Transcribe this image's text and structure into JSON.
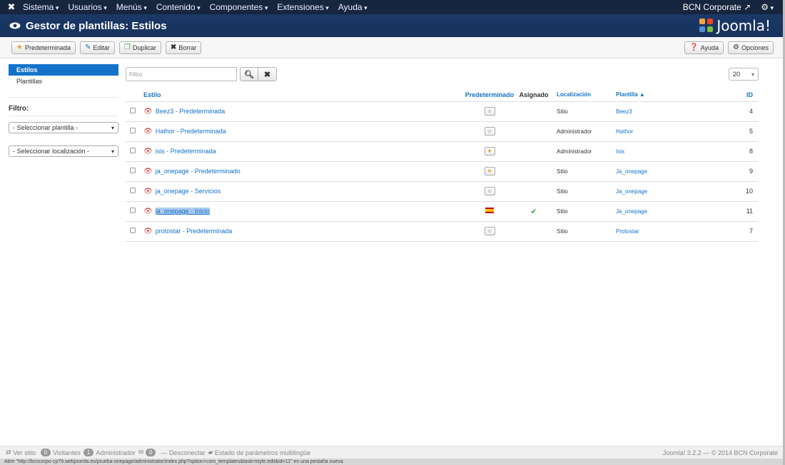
{
  "topnav": {
    "menu": [
      "Sistema",
      "Usuarios",
      "Menús",
      "Contenido",
      "Componentes",
      "Extensiones",
      "Ayuda"
    ],
    "site_name": "BCN Corporate"
  },
  "header": {
    "title": "Gestor de plantillas: Estilos",
    "brand": "Joomla!"
  },
  "toolbar": {
    "default_label": "Predeterminada",
    "edit_label": "Editar",
    "duplicate_label": "Duplicar",
    "delete_label": "Borrar",
    "help_label": "Ayuda",
    "options_label": "Opciones"
  },
  "sidebar": {
    "items": [
      "Estilos",
      "Plantillas"
    ],
    "filter_title": "Filtro:",
    "select_template": "- Seleccionar plantilla -",
    "select_location": "- Seleccionar localización -"
  },
  "filter": {
    "placeholder": "Filtro:",
    "limit": "20"
  },
  "table": {
    "headers": {
      "style": "Estilo",
      "default": "Predeterminado",
      "assigned": "Asignado",
      "location": "Localización",
      "template": "Plantilla ▲",
      "id": "ID"
    },
    "rows": [
      {
        "name": "Beez3 - Predeterminada",
        "default": "off",
        "location": "Sitio",
        "template": "Beez3",
        "id": "4"
      },
      {
        "name": "Hathor - Predeterminada",
        "default": "off",
        "location": "Administrador",
        "template": "Hathor",
        "id": "5"
      },
      {
        "name": "isis - Predeterminada",
        "default": "on",
        "location": "Administrador",
        "template": "Isis",
        "id": "8"
      },
      {
        "name": "ja_onepage - Predeterminado",
        "default": "on",
        "location": "Sitio",
        "template": "Ja_onepage",
        "id": "9"
      },
      {
        "name": "ja_onepage - Servicios",
        "default": "off",
        "location": "Sitio",
        "template": "Ja_onepage",
        "id": "10"
      },
      {
        "name": "ja_onepage - Inicio",
        "default": "flag",
        "assigned": true,
        "location": "Sitio",
        "template": "Ja_onepage",
        "id": "11"
      },
      {
        "name": "protostar - Predeterminada",
        "default": "off",
        "location": "Sitio",
        "template": "Protostar",
        "id": "7"
      }
    ]
  },
  "footer": {
    "view_site": "Ver sitio",
    "visitors_count": "0",
    "visitors": "Visitantes",
    "admin_count": "1",
    "admin": "Administrador",
    "msg_count": "0",
    "logout": "Desconectar",
    "multilang": "Estado de parámetros multilingüe",
    "copyright": "Joomla! 3.2.2 — © 2014 BCN Corporate"
  },
  "status_bar": "Abrir \"http://bcncorpo-cp79.webjoomla.es/prueba-onepage/administrator/index.php?option=com_templates&task=style.edit&id=11\" en una pestaña nueva",
  "colors": {
    "nav_bg": "#16263f",
    "header_bg": "#1a3867",
    "link": "#1473c9",
    "active_side": "#1473c9"
  }
}
